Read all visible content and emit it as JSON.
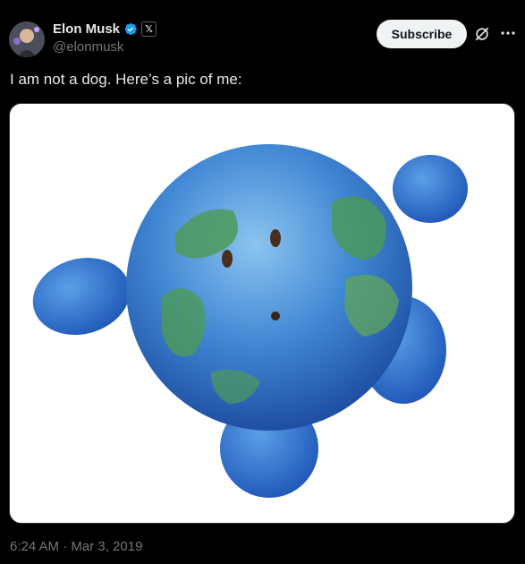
{
  "author": {
    "name": "Elon Musk",
    "handle": "@elonmusk",
    "verified_icon": "verified-badge-icon",
    "affiliation_icon": "x-logo-icon",
    "affiliation_mark": "𝕏"
  },
  "actions": {
    "subscribe_label": "Subscribe",
    "grok_icon": "grok-icon",
    "more_icon": "more-icon"
  },
  "tweet": {
    "text": "I am not a dog. Here’s a pic of me:",
    "media_description_icon": "plush-earth-image"
  },
  "meta": {
    "timestamp": "6:24 AM · Mar 3, 2019"
  },
  "colors": {
    "background": "#000000",
    "text": "#e7e9ea",
    "secondary_text": "#71767b",
    "verified_blue": "#1d9bf0",
    "button_bg": "#eff3f4"
  }
}
